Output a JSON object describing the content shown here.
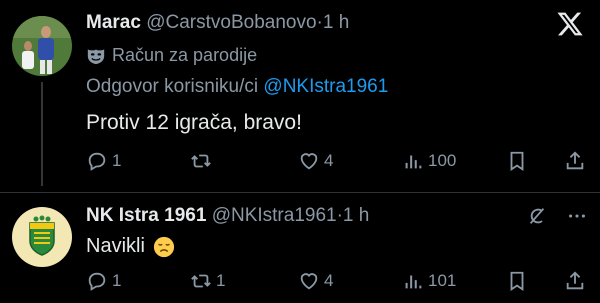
{
  "colors": {
    "background": "#000000",
    "text_primary": "#e7e9ea",
    "text_secondary": "#8b98a5",
    "link": "#1d9bf0",
    "divider": "#2f3336"
  },
  "app": {
    "logo_icon": "x-logo-icon"
  },
  "tweet1": {
    "display_name": "Marac",
    "handle": "@CarstvoBobanovo",
    "separator": "·",
    "time": "1 h",
    "parody_label": "Račun za parodije",
    "parody_icon": "parody-mask-icon",
    "reply_prefix": "Odgovor korisniku/ci",
    "reply_mention": "@NKIstra1961",
    "text": "Protiv 12 igrača, bravo!",
    "actions": {
      "reply_count": "1",
      "retweet_count": "",
      "like_count": "4",
      "views_count": "100"
    }
  },
  "tweet2": {
    "display_name": "NK Istra 1961",
    "handle": "@NKIstra1961",
    "separator": "·",
    "time": "1 h",
    "text": "Navikli",
    "emoji": "😩",
    "actions": {
      "reply_count": "1",
      "retweet_count": "1",
      "like_count": "4",
      "views_count": "101"
    }
  }
}
